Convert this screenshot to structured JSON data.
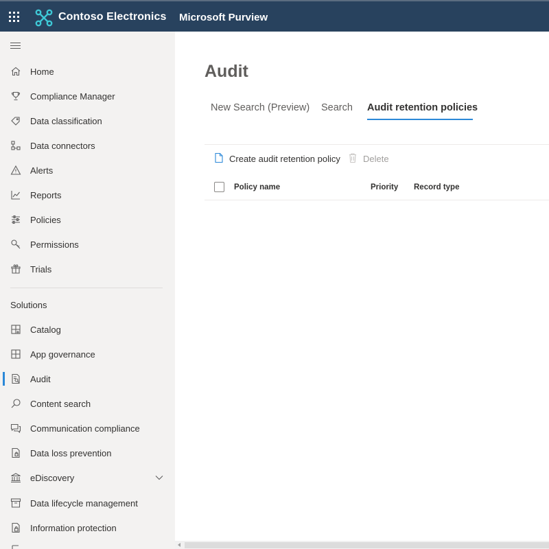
{
  "header": {
    "org_name": "Contoso Electronics",
    "app_name": "Microsoft Purview",
    "background_color": "#28425e",
    "logo_color": "#3ec8d6"
  },
  "sidebar": {
    "top_items": [
      {
        "label": "Home",
        "icon": "home-icon"
      },
      {
        "label": "Compliance Manager",
        "icon": "trophy-icon"
      },
      {
        "label": "Data classification",
        "icon": "tag-icon"
      },
      {
        "label": "Data connectors",
        "icon": "connector-icon"
      },
      {
        "label": "Alerts",
        "icon": "warning-icon"
      },
      {
        "label": "Reports",
        "icon": "chart-line-icon"
      },
      {
        "label": "Policies",
        "icon": "sliders-icon"
      },
      {
        "label": "Permissions",
        "icon": "key-icon"
      },
      {
        "label": "Trials",
        "icon": "sparkle-icon"
      }
    ],
    "solutions_title": "Solutions",
    "solution_items": [
      {
        "label": "Catalog",
        "icon": "catalog-icon"
      },
      {
        "label": "App governance",
        "icon": "grid-icon"
      },
      {
        "label": "Audit",
        "icon": "audit-document-icon",
        "active": true
      },
      {
        "label": "Content search",
        "icon": "search-icon"
      },
      {
        "label": "Communication compliance",
        "icon": "chat-icon"
      },
      {
        "label": "Data loss prevention",
        "icon": "dlp-document-icon"
      },
      {
        "label": "eDiscovery",
        "icon": "courthouse-icon",
        "expandable": true
      },
      {
        "label": "Data lifecycle management",
        "icon": "archive-icon"
      },
      {
        "label": "Information protection",
        "icon": "lock-document-icon"
      }
    ],
    "active_color": "#2b88d8"
  },
  "main": {
    "title": "Audit",
    "tabs": [
      {
        "label": "New Search (Preview)"
      },
      {
        "label": "Search"
      },
      {
        "label": "Audit retention policies",
        "active": true
      }
    ],
    "commands": {
      "create_label": "Create audit retention policy",
      "delete_label": "Delete"
    },
    "columns": [
      "Policy name",
      "Priority",
      "Record type"
    ]
  }
}
